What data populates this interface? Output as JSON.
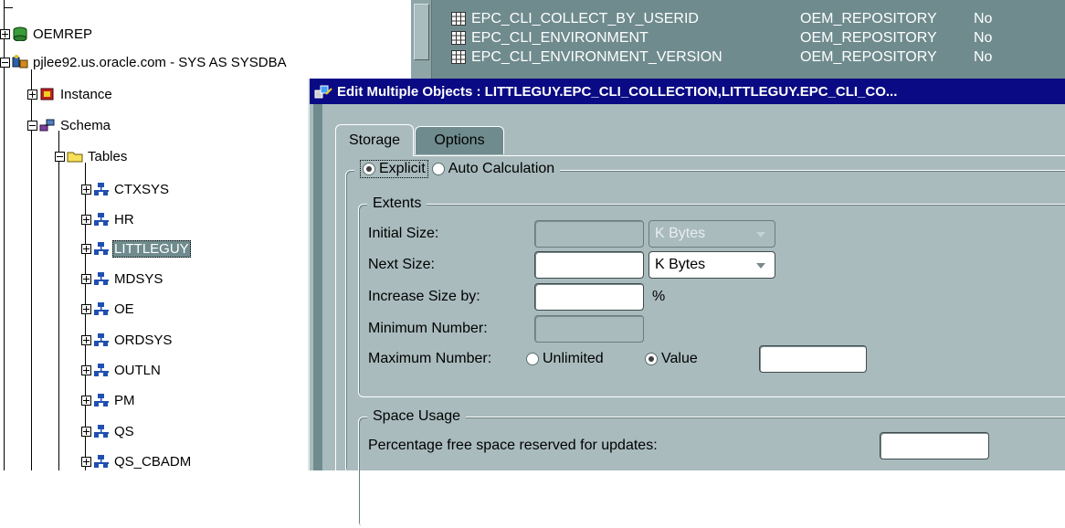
{
  "navigator": {
    "nodes": [
      {
        "label": "OEMREP",
        "icon": "database-icon"
      },
      {
        "label": "pjlee92.us.oracle.com - SYS AS SYSDBA",
        "icon": "database-connection-icon"
      },
      {
        "label": "Instance",
        "icon": "instance-icon"
      },
      {
        "label": "Schema",
        "icon": "schema-icon"
      },
      {
        "label": "Tables",
        "icon": "folder-icon"
      },
      {
        "label": "CTXSYS",
        "icon": "schema-user-icon"
      },
      {
        "label": "HR",
        "icon": "schema-user-icon"
      },
      {
        "label": "LITTLEGUY",
        "icon": "schema-user-icon",
        "selected": true
      },
      {
        "label": "MDSYS",
        "icon": "schema-user-icon"
      },
      {
        "label": "OE",
        "icon": "schema-user-icon"
      },
      {
        "label": "ORDSYS",
        "icon": "schema-user-icon"
      },
      {
        "label": "OUTLN",
        "icon": "schema-user-icon"
      },
      {
        "label": "PM",
        "icon": "schema-user-icon"
      },
      {
        "label": "QS",
        "icon": "schema-user-icon"
      },
      {
        "label": "QS_CBADM",
        "icon": "schema-user-icon"
      }
    ]
  },
  "table_list": {
    "rows": [
      {
        "name": "EPC_CLI_COLLECT_BY_USERID",
        "schema": "OEM_REPOSITORY",
        "flag": "No"
      },
      {
        "name": "EPC_CLI_ENVIRONMENT",
        "schema": "OEM_REPOSITORY",
        "flag": "No"
      },
      {
        "name": "EPC_CLI_ENVIRONMENT_VERSION",
        "schema": "OEM_REPOSITORY",
        "flag": "No"
      }
    ]
  },
  "dialog": {
    "title": "Edit Multiple Objects : LITTLEGUY.EPC_CLI_COLLECTION,LITTLEGUY.EPC_CLI_CO...",
    "tabs": [
      {
        "label": "Storage",
        "active": true
      },
      {
        "label": "Options",
        "active": false
      }
    ],
    "storage": {
      "mode_explicit": "Explicit",
      "mode_auto": "Auto Calculation",
      "mode_selected": "Explicit",
      "extents": {
        "legend": "Extents",
        "initial_size_label": "Initial Size:",
        "initial_size_value": "",
        "initial_unit": "K Bytes",
        "next_size_label": "Next Size:",
        "next_size_value": "",
        "next_unit": "K Bytes",
        "increase_label": "Increase Size by:",
        "increase_value": "",
        "increase_unit": "%",
        "min_label": "Minimum Number:",
        "min_value": "",
        "max_label": "Maximum Number:",
        "max_unlimited": "Unlimited",
        "max_value_option": "Value",
        "max_selected": "Value",
        "max_value": ""
      },
      "space_usage": {
        "legend": "Space Usage",
        "pct_free_label": "Percentage free space reserved for updates:",
        "pct_free_value": ""
      }
    }
  },
  "colors": {
    "selection": "#6f8b8e",
    "dialog_bg": "#a9bbbd",
    "titlebar": "#0a0a84"
  }
}
